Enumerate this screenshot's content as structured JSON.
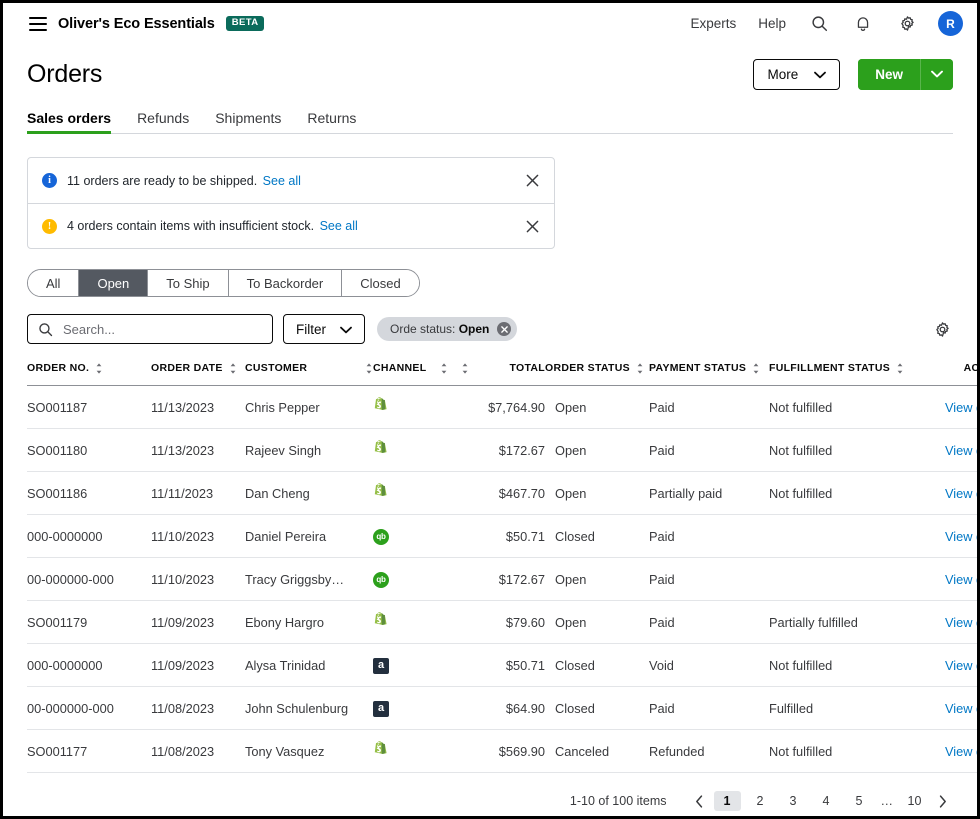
{
  "appbar": {
    "brand": "Oliver's Eco Essentials",
    "badge": "BETA",
    "links": [
      "Experts",
      "Help"
    ],
    "avatar_initial": "R",
    "icons": [
      "search-icon",
      "bell-icon",
      "gear-icon"
    ]
  },
  "header": {
    "title": "Orders",
    "more_label": "More",
    "new_label": "New"
  },
  "tabs": [
    {
      "label": "Sales orders",
      "active": true
    },
    {
      "label": "Refunds",
      "active": false
    },
    {
      "label": "Shipments",
      "active": false
    },
    {
      "label": "Returns",
      "active": false
    }
  ],
  "notices": [
    {
      "type": "info",
      "glyph": "i",
      "text": "11 orders are ready to be shipped.",
      "link": "See all"
    },
    {
      "type": "warn",
      "glyph": "!",
      "text": "4 orders contain items with insufficient stock.",
      "link": "See all"
    }
  ],
  "segments": [
    {
      "label": "All",
      "active": false
    },
    {
      "label": "Open",
      "active": true
    },
    {
      "label": "To Ship",
      "active": false
    },
    {
      "label": "To Backorder",
      "active": false
    },
    {
      "label": "Closed",
      "active": false
    }
  ],
  "toolbar": {
    "search_placeholder": "Search...",
    "search_value": "",
    "filter_label": "Filter",
    "chip_prefix": "Orde status:",
    "chip_value": "Open"
  },
  "table": {
    "columns": [
      {
        "label": "ORDER NO.",
        "sortable": true,
        "align": "left"
      },
      {
        "label": "ORDER DATE",
        "sortable": true,
        "align": "left"
      },
      {
        "label": "CUSTOMER",
        "sortable": true,
        "align": "spread"
      },
      {
        "label": "CHANNEL",
        "sortable": true,
        "align": "spread"
      },
      {
        "label": "TOTAL",
        "sortable": false,
        "align": "num"
      },
      {
        "label": "ORDER STATUS",
        "sortable": true,
        "align": "left"
      },
      {
        "label": "PAYMENT STATUS",
        "sortable": true,
        "align": "left"
      },
      {
        "label": "FULFILLMENT STATUS",
        "sortable": true,
        "align": "left"
      },
      {
        "label": "ACTIONS",
        "sortable": false,
        "align": "actions"
      }
    ],
    "action_label": "View details",
    "rows": [
      {
        "order_no": "SO001187",
        "order_date": "11/13/2023",
        "customer": "Chris Pepper",
        "channel": "shopify",
        "total": "$7,764.90",
        "order_status": "Open",
        "payment_status": "Paid",
        "fulfillment_status": "Not fulfilled"
      },
      {
        "order_no": "SO001180",
        "order_date": "11/13/2023",
        "customer": "Rajeev Singh",
        "channel": "shopify",
        "total": "$172.67",
        "order_status": "Open",
        "payment_status": "Paid",
        "fulfillment_status": "Not fulfilled"
      },
      {
        "order_no": "SO001186",
        "order_date": "11/11/2023",
        "customer": "Dan Cheng",
        "channel": "shopify",
        "total": "$467.70",
        "order_status": "Open",
        "payment_status": "Partially paid",
        "fulfillment_status": "Not fulfilled"
      },
      {
        "order_no": "000-0000000",
        "order_date": "11/10/2023",
        "customer": "Daniel Pereira",
        "channel": "quickbooks",
        "total": "$50.71",
        "order_status": "Closed",
        "payment_status": "Paid",
        "fulfillment_status": ""
      },
      {
        "order_no": "00-000000-000",
        "order_date": "11/10/2023",
        "customer": "Tracy Griggsby…",
        "channel": "quickbooks",
        "total": "$172.67",
        "order_status": "Open",
        "payment_status": "Paid",
        "fulfillment_status": ""
      },
      {
        "order_no": "SO001179",
        "order_date": "11/09/2023",
        "customer": "Ebony Hargro",
        "channel": "shopify",
        "total": "$79.60",
        "order_status": "Open",
        "payment_status": "Paid",
        "fulfillment_status": "Partially fulfilled"
      },
      {
        "order_no": "000-0000000",
        "order_date": "11/09/2023",
        "customer": "Alysa Trinidad",
        "channel": "amazon",
        "total": "$50.71",
        "order_status": "Closed",
        "payment_status": "Void",
        "fulfillment_status": "Not fulfilled"
      },
      {
        "order_no": "00-000000-000",
        "order_date": "11/08/2023",
        "customer": "John Schulenburg",
        "channel": "amazon",
        "total": "$64.90",
        "order_status": "Closed",
        "payment_status": "Paid",
        "fulfillment_status": "Fulfilled"
      },
      {
        "order_no": "SO001177",
        "order_date": "11/08/2023",
        "customer": "Tony Vasquez",
        "channel": "shopify",
        "total": "$569.90",
        "order_status": "Canceled",
        "payment_status": "Refunded",
        "fulfillment_status": "Not fulfilled"
      }
    ]
  },
  "pagination": {
    "summary": "1-10 of 100 items",
    "pages": [
      "1",
      "2",
      "3",
      "4",
      "5",
      "…",
      "10"
    ],
    "current": "1"
  },
  "colors": {
    "brand_green": "#2ca01c",
    "beta_teal": "#0b6b5b",
    "link_blue": "#0077c5",
    "info_blue": "#1665d8",
    "warn_yellow": "#ffbb00",
    "avatar_blue": "#1665d8",
    "segment_active": "#545961"
  }
}
